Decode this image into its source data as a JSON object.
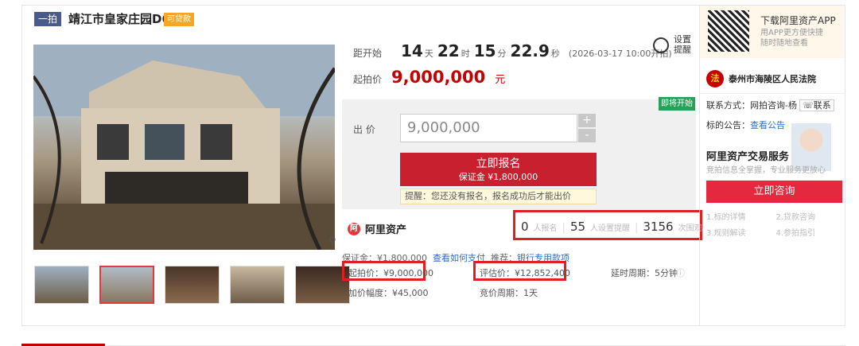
{
  "header": {
    "lot_tag": "一拍",
    "title": "靖江市皇家庄园D6",
    "loan_badge": "可贷款"
  },
  "countdown": {
    "label": "距开始",
    "days": "14",
    "days_unit": "天",
    "hours": "22",
    "hours_unit": "时",
    "minutes": "15",
    "minutes_unit": "分",
    "seconds": "22.9",
    "seconds_unit": "秒",
    "start_time": "(2026-03-17 10:00开拍)"
  },
  "reminder": {
    "line1": "设置",
    "line2": "提醒"
  },
  "start_price": {
    "label": "起拍价",
    "value": "9,000,000",
    "unit": "元"
  },
  "bid": {
    "status_badge": "即将开始",
    "label": "出 价",
    "input_value": "9,000,000",
    "plus": "+",
    "minus": "-",
    "signup_label": "立即报名",
    "deposit_label": "保证金 ¥1,800,000",
    "warning": "提醒：您还没有报名，报名成功后才能出价"
  },
  "brand": {
    "logo": "阿",
    "name": "阿里资产"
  },
  "stats": {
    "signups": "0",
    "signups_label": "人报名",
    "reminders": "55",
    "reminders_label": "人设置提醒",
    "views": "3156",
    "views_label": "次围观"
  },
  "details": {
    "deposit_text": "保证金：¥1,800,000",
    "pay_link": "查看如何支付",
    "recommend_label": "推荐：",
    "recommend_link": "银行专用款项",
    "start_price": "起拍价：¥9,000,000",
    "appraisal": "评估价：¥12,852,400",
    "extension": "延时周期：5分钟",
    "increment": "加价幅度：¥45,000",
    "auction_period": "竞价周期：1天"
  },
  "app": {
    "title": "下载阿里资产APP",
    "line1": "用APP更方便快捷",
    "line2": "随时随地查看"
  },
  "court": {
    "logo": "法",
    "name": "泰州市海陵区人民法院"
  },
  "contact": {
    "label": "联系方式：网拍咨询-杨",
    "button": "联系"
  },
  "notice": {
    "label": "标的公告：",
    "link": "查看公告"
  },
  "service": {
    "title": "阿里资产交易服务",
    "subtitle": "竞拍信息全掌握，专业服务更放心",
    "consult_button": "立即咨询",
    "items": [
      "1.标的详情",
      "2.贷款咨询",
      "3.规则解读",
      "4.参拍指引"
    ]
  },
  "zoom_icon": "magnifier-icon",
  "colors": {
    "accent_red": "#c40000",
    "button_red": "#c8202f",
    "highlight_box": "#e02020",
    "status_green": "#27a05a"
  }
}
